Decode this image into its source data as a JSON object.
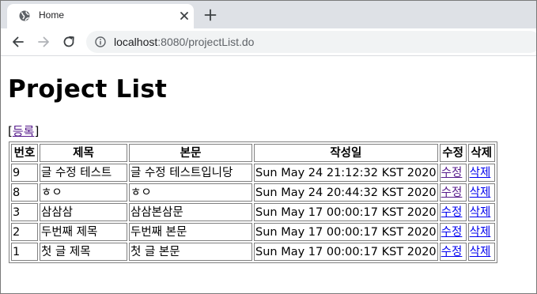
{
  "browser": {
    "tab_title": "Home",
    "url_host": "localhost",
    "url_rest": ":8080/projectList.do"
  },
  "page": {
    "heading": "Project List",
    "register_open": "[",
    "register_link": "등록",
    "register_close": "]",
    "table": {
      "headers": [
        "번호",
        "제목",
        "본문",
        "작성일",
        "수정",
        "삭제"
      ],
      "rows": [
        {
          "no": "9",
          "title": "글 수정 테스트",
          "body": "글 수정 테스트입니당",
          "date": "Sun May 24 21:12:32 KST 2020",
          "edit": "수정",
          "del": "삭제"
        },
        {
          "no": "8",
          "title": "ㅎㅇ",
          "body": "ㅎㅇ",
          "date": "Sun May 24 20:44:32 KST 2020",
          "edit": "수정",
          "del": "삭제"
        },
        {
          "no": "3",
          "title": "삼삼삼",
          "body": "삼삼본삼문",
          "date": "Sun May 17 00:00:17 KST 2020",
          "edit": "수정",
          "del": "삭제"
        },
        {
          "no": "2",
          "title": "두번째 제목",
          "body": "두번째 본문",
          "date": "Sun May 17 00:00:17 KST 2020",
          "edit": "수정",
          "del": "삭제"
        },
        {
          "no": "1",
          "title": "첫 글 제목",
          "body": "첫 글 본문",
          "date": "Sun May 17 00:00:17 KST 2020",
          "edit": "수정",
          "del": "삭제"
        }
      ]
    }
  },
  "icons": {
    "favicon": "globe-icon",
    "tab_close": "close-icon",
    "new_tab": "plus-icon",
    "back": "arrow-left-icon",
    "forward": "arrow-right-icon",
    "reload": "reload-icon",
    "site_info": "info-icon"
  },
  "colors": {
    "tabstrip": "#dee1e6",
    "omnibox": "#f1f3f4",
    "link": "#0000ee",
    "visited_link": "#551a8b"
  }
}
